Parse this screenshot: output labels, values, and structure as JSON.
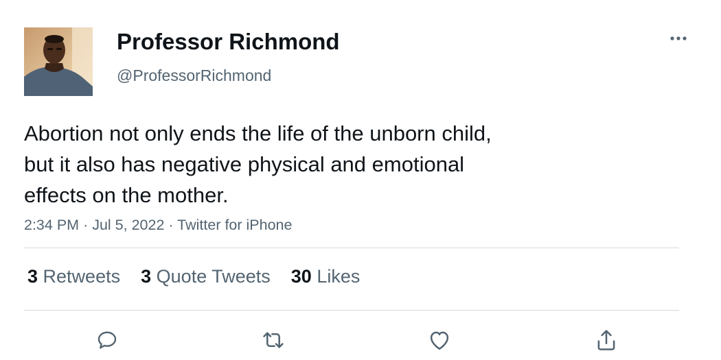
{
  "author": {
    "display_name": "Professor Richmond",
    "handle": "@ProfessorRichmond"
  },
  "tweet": {
    "text": "Abortion not only ends the life of the unborn child,\nbut it also has negative physical and emotional\neffects on the mother.",
    "time": "2:34 PM",
    "date": "Jul 5, 2022",
    "source": "Twitter for iPhone",
    "separator": "·"
  },
  "stats": [
    {
      "count": "3",
      "label": "Retweets"
    },
    {
      "count": "3",
      "label": "Quote Tweets"
    },
    {
      "count": "30",
      "label": "Likes"
    }
  ],
  "actions": [
    {
      "icon": "reply-icon"
    },
    {
      "icon": "retweet-icon"
    },
    {
      "icon": "like-icon"
    },
    {
      "icon": "share-icon"
    }
  ],
  "colors": {
    "text": "#0f1419",
    "secondary": "#536471",
    "divider": "#d5d9dc"
  }
}
